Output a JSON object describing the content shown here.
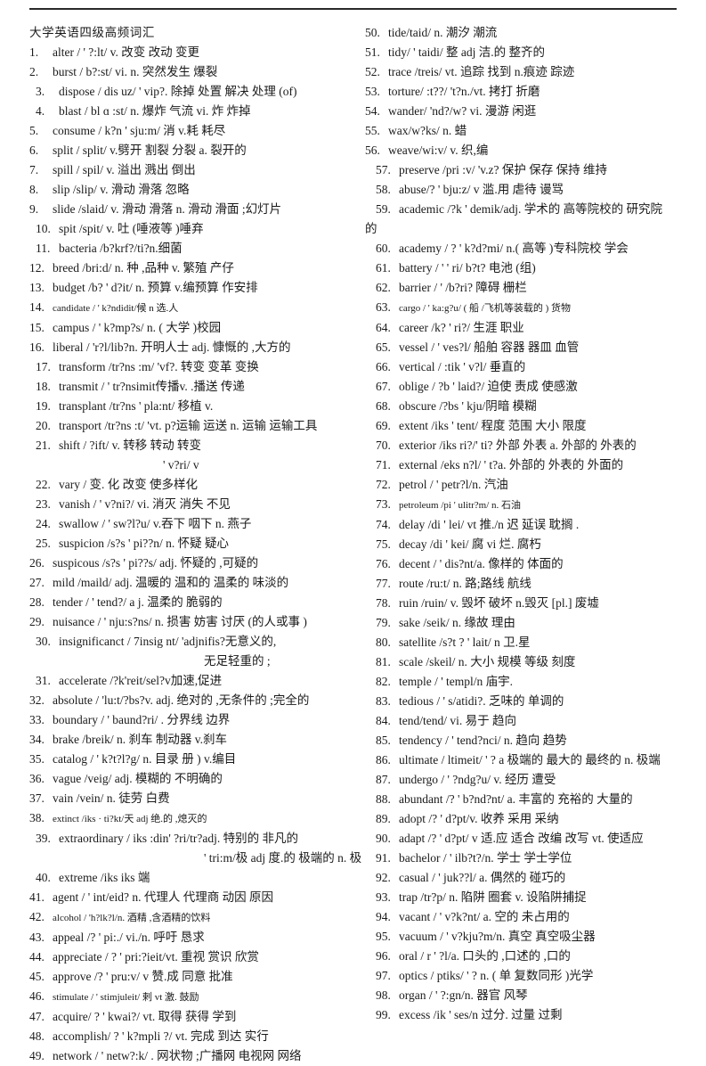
{
  "document": {
    "title": "大学英语四级高频词汇",
    "has_top_rule": true,
    "columns": 2,
    "total_entries": 99
  },
  "left_column": [
    {
      "num": "1.",
      "text": "alter /  ' ?:lt/  v. 改变  改动  变更"
    },
    {
      "num": "2.",
      "text": "burst / b?:st/ vi. n.   突然发生  爆裂"
    },
    {
      "num": "3.",
      "text": "dispose / dis   uz/ '  vip?. 除掉  处置 解决  处理 (of)"
    },
    {
      "num": "4.",
      "text": "blast / bl  ɑ :st/ n. 爆炸  气流  vi.  炸  炸掉"
    },
    {
      "num": "5.",
      "text": "consume / k?n   '   sju:m/  消 v.耗  耗尽"
    },
    {
      "num": "6.",
      "text": "split / split/     v.劈开  割裂  分裂  a. 裂开的"
    },
    {
      "num": "7.",
      "text": "spill / spil/ v.   溢出   溅出   倒出"
    },
    {
      "num": "8.",
      "text": "slip /slip/ v.   滑动  滑落  忽略"
    },
    {
      "num": "9.",
      "text": "slide /slaid/ v.    滑动  滑落  n. 滑动   滑面  ;幻灯片"
    },
    {
      "num": "10.",
      "text": "spit  /spit/ v.   吐 (唾液等 )唾弃"
    },
    {
      "num": "11.",
      "text": "bacteria /b?krf?/ti?n.细菌"
    },
    {
      "num": "12.",
      "text": "breed /bri:d/ n.    种 ,品种  v. 繁殖  产仔"
    },
    {
      "num": "13.",
      "text": "budget /b?    '  d?it/ n. 预算  v.编预算  作安排"
    },
    {
      "num": "14.",
      "text": "candidate /  ' k?ndidit/候 n 选.人"
    },
    {
      "num": "15.",
      "text": "campus /     ' k?mp?s/ n. (  大学 )校园"
    },
    {
      "num": "16.",
      "text": "liberal / 'r?l/lib?n. 开明人士   adj. 慷慨的  ,大方的"
    },
    {
      "num": "17.",
      "text": "transform /tr?ns          :m/  'vf?. 转变  变革  变换"
    },
    {
      "num": "18.",
      "text": "transmit /               ' tr?nsimit传播v. .播送 传递"
    },
    {
      "num": "19.",
      "text": "transplant /tr?ns             '  pla:nt/ 移植 v."
    },
    {
      "num": "20.",
      "text": "transport /tr?ns            :t/  'vt. p?运输 运送 n. 运输 运输工具"
    },
    {
      "num": "21.",
      "text": "shift / ?ift/    v. 转移  转动  转变"
    },
    {
      "num": "22.",
      "text": "vary /    变.              化  改变  使多样化",
      "cont_before": "' v?ri/ v"
    },
    {
      "num": "23.",
      "text": "vanish      /  ' v?ni?/ vi.   消灭  消失  不见"
    },
    {
      "num": "24.",
      "text": "swallow /           ' sw?l?u/ v.吞下 咽下 n. 燕子"
    },
    {
      "num": "25.",
      "text": "suspicion /s?s      '  pi??n/  n.   怀疑  疑心"
    },
    {
      "num": "26.",
      "text": "suspicous /s?s       '  pi??s/ adj. 怀疑的  ,可疑的"
    },
    {
      "num": "27.",
      "text": "mild /maild/ adj.   温暖的  温和的   温柔的  味淡的"
    },
    {
      "num": "28.",
      "text": "tender /      ' tend?/ a j.  温柔的  脆弱的"
    },
    {
      "num": "29.",
      "text": "nuisance /      ' nju:s?ns/ n.   损害  妨害  讨厌 (的人或事 )"
    },
    {
      "num": "30.",
      "text": "insignificanct / 7insig              nt/ 'adjnifis?无意义的,",
      "cont_after": "无足轻重的 ;"
    },
    {
      "num": "31.",
      "text": "accelerate /?k'reit/sel?v加速,促进"
    },
    {
      "num": "32.",
      "text": "absolute /   'lu:t/?bs?v. adj.    绝对的 ,无条件的 ;完全的"
    },
    {
      "num": "33.",
      "text": "boundary /      ' baund?ri/ .   分界线  边界"
    },
    {
      "num": "34.",
      "text": "brake /breik/ n.   刹车  制动器 v.刹车"
    },
    {
      "num": "35.",
      "text": "catalog /  ' k?t?l?g/ n. 目录  册 ) v.编目"
    },
    {
      "num": "36.",
      "text": "vague /veig/      adj. 模糊的  不明确的"
    },
    {
      "num": "37.",
      "text": "vain /vein/ n.   徒劳  白费"
    },
    {
      "num": "38.",
      "text": "extinct /iks  ·  ti?kt/天 adj 绝.的  ,熄灭的"
    },
    {
      "num": "39.",
      "text": "extraordinary / iks            :din'  ?ri/tr?adj. 特别的  非凡的",
      "cont_after": "' tri:m/极 adj 度.的  极端的 n. 极"
    },
    {
      "num": "40.",
      "text": "extreme  /iks iks               端"
    },
    {
      "num": "41.",
      "text": "agent /       ' int/eid? n. 代理人  代理商  动因  原因"
    },
    {
      "num": "42.",
      "text": "alcohol /  'h?lk?l/n.   酒精 ,含酒精的饮料"
    },
    {
      "num": "43.",
      "text": "appeal      /?  ' pi:./ vi./n.   呼吁  恳求"
    },
    {
      "num": "44.",
      "text": "appreciate / ?  '   pri:?ieit/vt. 重视  赏识  欣赏"
    },
    {
      "num": "45.",
      "text": "approve /?  '   pru:v/ v 赞.成  同意  批准"
    },
    {
      "num": "46.",
      "text": "stimulate /  ' stimjuleit/ 剌 vt 激.  鼓励"
    },
    {
      "num": "47.",
      "text": "acquire/ ?  '  kwai?/ vt. 取得  获得  学到"
    },
    {
      "num": "48.",
      "text": "accomplish/ ?  '   k?mpli ?/ vt. 完成  到达  实行"
    },
    {
      "num": "49.",
      "text": "network /      ' netw?:k/ .   网状物 ;广播网  电视网  网络"
    }
  ],
  "right_column": [
    {
      "num": "50.",
      "text": "tide/taid/ n.  潮汐  潮流"
    },
    {
      "num": "51.",
      "text": "tidy/   ' taidi/ 整 adj 洁.的  整齐的"
    },
    {
      "num": "52.",
      "text": "trace /treis/ vt.  追踪  找到  n.痕迹  踪迹"
    },
    {
      "num": "53.",
      "text": "torture/  :t??/   't?n./vt.   拷打  折磨"
    },
    {
      "num": "54.",
      "text": "wander/    'nd?/w? vi.  漫游  闲逛"
    },
    {
      "num": "55.",
      "text": "wax/w?ks/ n.   蜡"
    },
    {
      "num": "56.",
      "text": "weave/wi:v/ v.  织,编"
    },
    {
      "num": "57.",
      "text": "preserve /pri            :v/ 'v.z? 保护  保存  保持  维持"
    },
    {
      "num": "58.",
      "text": "abuse/?    '  bju:z/ v 滥.用  虐待  谩骂"
    },
    {
      "num": "59.",
      "text": "academic /?k    '  demik/adj. 学术的  高等院校的  研究院",
      "cont_after": "的"
    },
    {
      "num": "60.",
      "text": "academy / ?  '   k?d?mi/ n.(  高等 )专科院校  学会"
    },
    {
      "num": "61.",
      "text": "battery /   '  ' ri/ b?t? 电池  (组)"
    },
    {
      "num": "62.",
      "text": "barrier /     '   /b?ri? 障碍  栅栏"
    },
    {
      "num": "63.",
      "text": "cargo /     '  ka:g?u/ ( 船 /飞机等装载的 ) 货物"
    },
    {
      "num": "64.",
      "text": "career /k?  '   ri?/ 生涯  职业"
    },
    {
      "num": "65.",
      "text": "vessel /   '   ves?l/   船舶  容器  器皿  血管"
    },
    {
      "num": "66.",
      "text": "vertical /  :tik  '   v?l/ 垂直的"
    },
    {
      "num": "67.",
      "text": "oblige / ?b  '   laid?/ 迫使  责成  使感激"
    },
    {
      "num": "68.",
      "text": "obscure /?bs    '  kju/阴暗  模糊"
    },
    {
      "num": "69.",
      "text": "extent /iks      '  tent/ 程度  范围  大小  限度"
    },
    {
      "num": "70.",
      "text": "exterior /iks            ri?/'  ti? 外部  外表  a. 外部的  外表的"
    },
    {
      "num": "71.",
      "text": "external /eks   n?l/   '   t?a. 外部的  外表的  外面的"
    },
    {
      "num": "72.",
      "text": "petrol /    '   petr?l/n.  汽油"
    },
    {
      "num": "73.",
      "text": "petroleum /pi            ' ulitr?m/ n. 石油"
    },
    {
      "num": "74.",
      "text": "delay /di     '   lei/ vt 推./n 迟  延误  耽搁 ."
    },
    {
      "num": "75.",
      "text": "decay /di    '   kei/ 腐 vi 烂.  腐朽"
    },
    {
      "num": "76.",
      "text": "decent /    '   dis?nt/a.  像样的  体面的"
    },
    {
      "num": "77.",
      "text": "route /ru:t/ n.    路;路线  航线"
    },
    {
      "num": "78.",
      "text": "ruin /ruin/ v. 毁坏  破坏 n.毁灭  [pl.] 废墟"
    },
    {
      "num": "79.",
      "text": "sake /seik/ n.   缘故  理由"
    },
    {
      "num": "80.",
      "text": "satellite /s?t ?  '   lait/ n 卫.星"
    },
    {
      "num": "81.",
      "text": "scale /skeil/ n. 大小  规模  等级  刻度"
    },
    {
      "num": "82.",
      "text": "temple /   '   templ/n 庙宇."
    },
    {
      "num": "83.",
      "text": "tedious /    ' s/atidi?. 乏味的  单调的"
    },
    {
      "num": "84.",
      "text": "tend/tend/ vi.  易于  趋向"
    },
    {
      "num": "85.",
      "text": "tendency /    '   tend?nci/ n.  趋向  趋势"
    },
    {
      "num": "86.",
      "text": "ultimate /  ltimeit/ ' ?  a 极端的  最大的  最终的 n. 极端"
    },
    {
      "num": "87.",
      "text": "undergo /   '  ?ndg?u/ v.  经历  遭受"
    },
    {
      "num": "88.",
      "text": "abundant /?  '   b?nd?nt/ a.    丰富的  充裕的  大量的"
    },
    {
      "num": "89.",
      "text": "adopt /?  '   d?pt/v. 收养  采用  采纳"
    },
    {
      "num": "90.",
      "text": "adapt /?  '   d?pt/ v 适.应  适合  改编  改写 vt. 使适应"
    },
    {
      "num": "91.",
      "text": "bachelor /    '   ilb?t?/n. 学士  学士学位"
    },
    {
      "num": "92.",
      "text": "casual /   '   juk??l/ a. 偶然的  碰巧的"
    },
    {
      "num": "93.",
      "text": "trap /tr?p/ n.  陷阱  圈套  v. 设陷阱捕捉"
    },
    {
      "num": "94.",
      "text": "vacant /   '   v?k?nt/ a.   空的  未占用的"
    },
    {
      "num": "95.",
      "text": "vacuum /  '   v?kju?m/n.  真空  真空吸尘器"
    },
    {
      "num": "96.",
      "text": "oral / r  '  ?l/a. 口头的 ,口述的 ,口的"
    },
    {
      "num": "97.",
      "text": "optics / ptiks/  ' ? n. ( 单  复数同形 )光学"
    },
    {
      "num": "98.",
      "text": "organ /   '   ?:gn/n.  器官  风琴"
    },
    {
      "num": "99.",
      "text": "excess /ik     '   ses/n  过分.  过量  过剩"
    }
  ]
}
